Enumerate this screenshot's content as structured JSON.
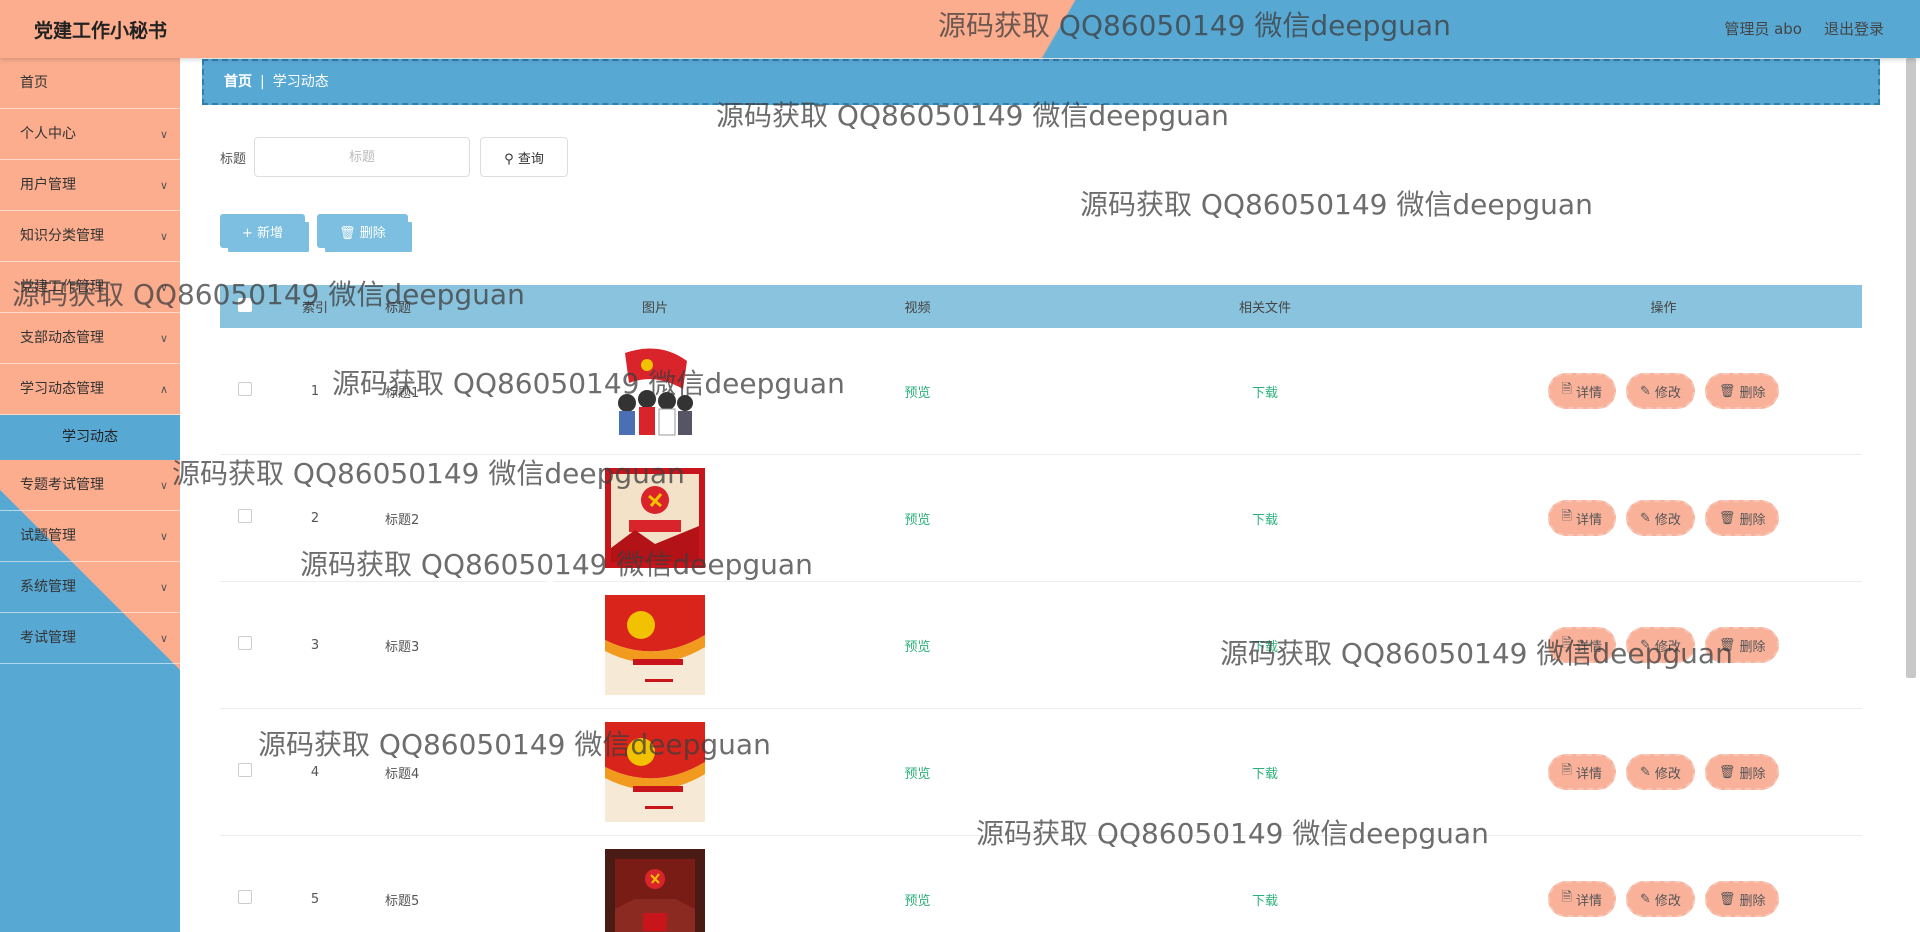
{
  "header": {
    "app_title": "党建工作小秘书",
    "user_label": "管理员 abo",
    "logout_label": "退出登录"
  },
  "sidebar": {
    "items": [
      {
        "label": "首页",
        "chevron": false
      },
      {
        "label": "个人中心",
        "chevron": true
      },
      {
        "label": "用户管理",
        "chevron": true
      },
      {
        "label": "知识分类管理",
        "chevron": true
      },
      {
        "label": "党建工作管理",
        "chevron": true
      },
      {
        "label": "支部动态管理",
        "chevron": true
      },
      {
        "label": "学习动态管理",
        "chevron": true
      },
      {
        "label": "专题考试管理",
        "chevron": true
      },
      {
        "label": "试题管理",
        "chevron": true
      },
      {
        "label": "系统管理",
        "chevron": true
      },
      {
        "label": "考试管理",
        "chevron": true
      }
    ],
    "active_sub": "学习动态"
  },
  "breadcrumb": {
    "home": "首页",
    "current": "学习动态"
  },
  "search": {
    "label": "标题",
    "placeholder": "标题",
    "query_button": "查询"
  },
  "actions": {
    "add": "新增",
    "delete": "删除"
  },
  "table": {
    "columns": {
      "index": "索引",
      "title": "标题",
      "image": "图片",
      "video": "视频",
      "file": "相关文件",
      "ops": "操作"
    },
    "rows": [
      {
        "index": "1",
        "title": "标题1",
        "video": "预览",
        "file": "下载"
      },
      {
        "index": "2",
        "title": "标题2",
        "video": "预览",
        "file": "下载"
      },
      {
        "index": "3",
        "title": "标题3",
        "video": "预览",
        "file": "下载"
      },
      {
        "index": "4",
        "title": "标题4",
        "video": "预览",
        "file": "下载"
      },
      {
        "index": "5",
        "title": "标题5",
        "video": "预览",
        "file": "下载"
      }
    ],
    "row_ops": {
      "detail": "详情",
      "edit": "修改",
      "delete": "删除"
    }
  },
  "watermark_text": "源码获取 QQ86050149 微信deepguan",
  "colors": {
    "salmon": "#fcad8e",
    "blue": "#58a8d4",
    "link_green": "#2cb07b"
  }
}
